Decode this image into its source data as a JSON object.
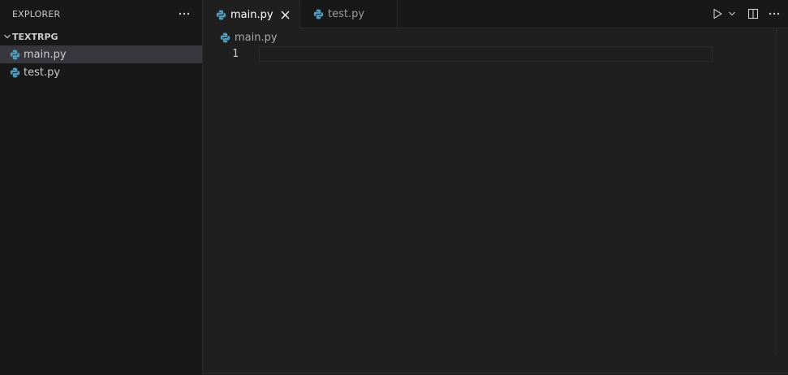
{
  "sidebar": {
    "title": "EXPLORER",
    "more_icon": "ellipsis-icon",
    "folder": {
      "name": "TEXTRPG",
      "expanded": true
    },
    "files": [
      {
        "name": "main.py",
        "selected": true,
        "icon": "python-icon"
      },
      {
        "name": "test.py",
        "selected": false,
        "icon": "python-icon"
      }
    ]
  },
  "tabs": [
    {
      "label": "main.py",
      "active": true,
      "icon": "python-icon",
      "close": "close-icon"
    },
    {
      "label": "test.py",
      "active": false,
      "icon": "python-icon"
    }
  ],
  "tab_actions": [
    "run-icon",
    "chevron-down-icon",
    "split-editor-icon",
    "ellipsis-icon"
  ],
  "breadcrumb": {
    "file": "main.py"
  },
  "editor": {
    "lines": [
      {
        "number": "1",
        "text": ""
      }
    ]
  },
  "colors": {
    "python_blue": "#519aba",
    "sidebar_bg": "#181818",
    "editor_bg": "#1f1f1f",
    "selected_row": "#37373d"
  }
}
